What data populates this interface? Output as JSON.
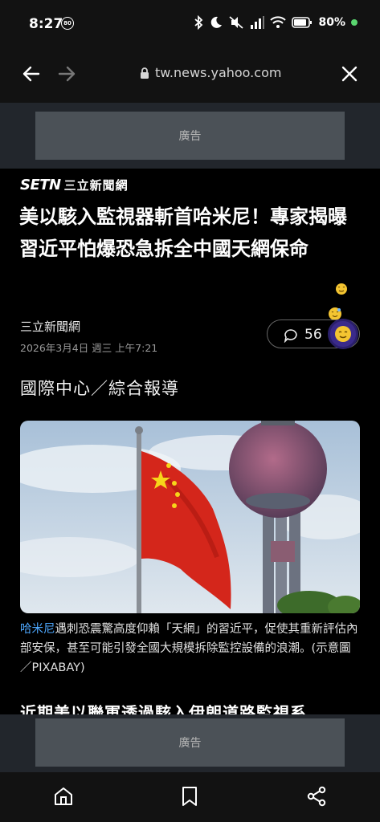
{
  "status_bar": {
    "time": "8:27",
    "badge": "80",
    "battery": "80%",
    "icons": [
      "bluetooth-icon",
      "moon-icon",
      "mute-icon",
      "signal-icon",
      "wifi-icon",
      "battery-icon"
    ]
  },
  "browser": {
    "url": "tw.news.yahoo.com",
    "back_icon": "arrow-left-icon",
    "forward_icon": "arrow-right-icon",
    "close_icon": "close-icon",
    "lock_icon": "lock-icon"
  },
  "ads": {
    "top_label": "廣告",
    "bottom_label": "廣告"
  },
  "article": {
    "source_logo_mark": "SETN",
    "source_logo_name": "三立新聞網",
    "headline": "美以駭入監視器斬首哈米尼！專家揭曝習近平怕爆恐急拆全中國天網保命",
    "publisher": "三立新聞網",
    "date": "2026年3月4日 週三 上午7:21",
    "comment_count": "56",
    "section": "國際中心／綜合報導",
    "caption_link": "哈米尼",
    "caption_text": "遇刺恐震驚高度仰賴「天網」的習近平，促使其重新評估內部安保，甚至可能引發全國大規模拆除監控設備的浪潮。(示意圖／PIXABAY)",
    "next_paragraph": "近期美以聯軍透過駭入伊朗道路監視系"
  },
  "bottom_nav": {
    "home_icon": "home-icon",
    "bookmark_icon": "bookmark-icon",
    "share_icon": "share-icon"
  },
  "colors": {
    "background": "#000000",
    "bar": "#121212",
    "ad_band": "#22262c",
    "ad_box": "#4b5157",
    "link": "#4ea8ff"
  }
}
